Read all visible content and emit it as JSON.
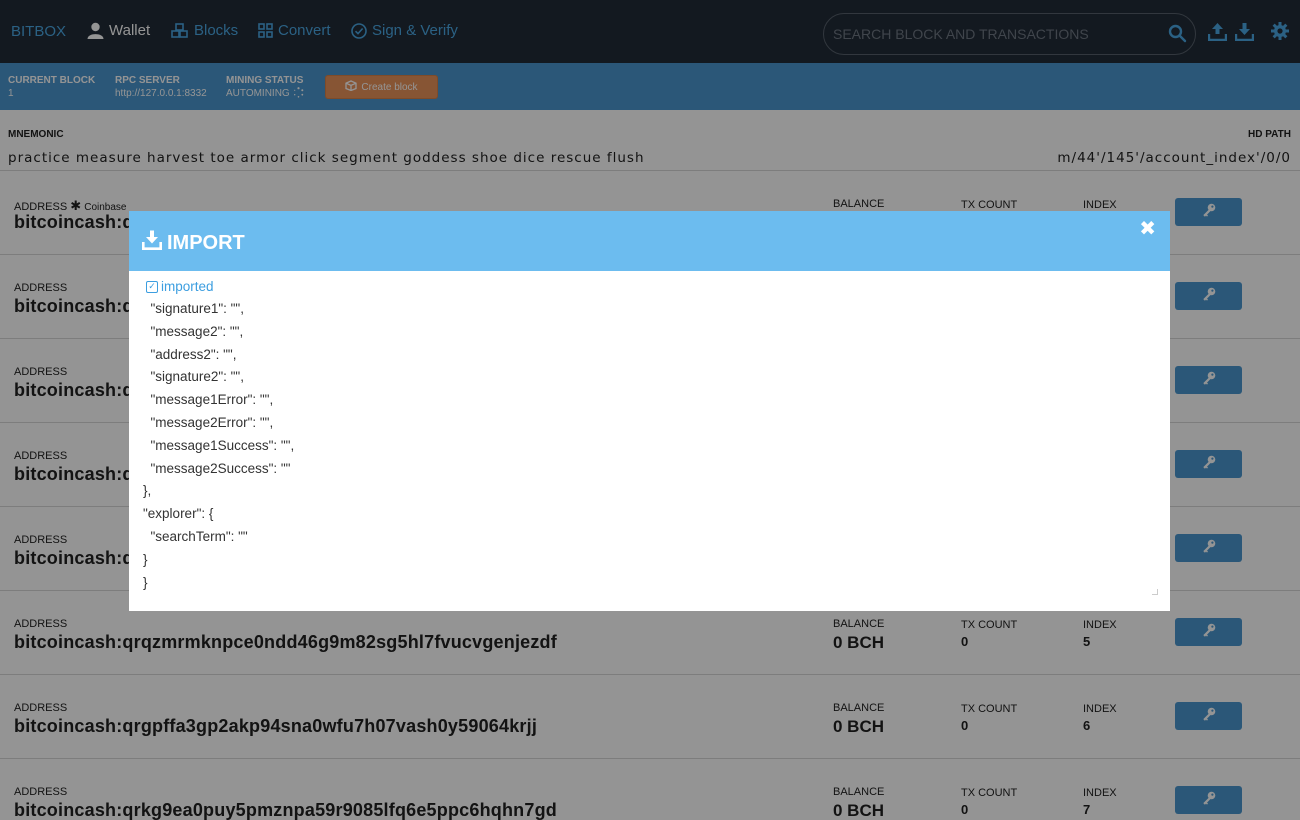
{
  "nav": {
    "brand": "BITBOX",
    "wallet": "Wallet",
    "blocks": "Blocks",
    "convert": "Convert",
    "sign": "Sign & Verify",
    "search_placeholder": "SEARCH BLOCK AND TRANSACTIONS",
    "icons": [
      "user-icon",
      "cubes-icon",
      "grid-icon",
      "check-circle-icon",
      "search-icon",
      "upload-icon",
      "download-icon",
      "gear-icon"
    ]
  },
  "status": {
    "current_block_label": "CURRENT BLOCK",
    "current_block_value": "1",
    "rpc_label": "RPC SERVER",
    "rpc_value": "http://127.0.0.1:8332",
    "mining_label": "MINING STATUS",
    "mining_value": "AUTOMINING",
    "create_block": "Create block"
  },
  "mnemonic": {
    "label": "MNEMONIC",
    "value": "practice measure harvest toe armor click segment goddess shoe dice rescue flush",
    "hd_label": "HD PATH",
    "hd_value": "m/44'/145'/account_index'/0/0"
  },
  "rows": [
    {
      "address_label": "ADDRESS",
      "coinbase": "Coinbase",
      "address": "bitcoincash:q",
      "balance_label": "BALANCE",
      "balance": "",
      "tx_label": "TX COUNT",
      "tx": "",
      "index_label": "INDEX",
      "index": ""
    },
    {
      "address_label": "ADDRESS",
      "address": "bitcoincash:q",
      "balance_label": "",
      "balance": "",
      "tx_label": "",
      "tx": "",
      "index_label": "",
      "index": ""
    },
    {
      "address_label": "ADDRESS",
      "address": "bitcoincash:q",
      "balance_label": "",
      "balance": "",
      "tx_label": "",
      "tx": "",
      "index_label": "",
      "index": ""
    },
    {
      "address_label": "ADDRESS",
      "address": "bitcoincash:q",
      "balance_label": "",
      "balance": "",
      "tx_label": "",
      "tx": "",
      "index_label": "",
      "index": ""
    },
    {
      "address_label": "ADDRESS",
      "address": "bitcoincash:q",
      "balance_label": "",
      "balance": "",
      "tx_label": "",
      "tx": "",
      "index_label": "",
      "index": ""
    },
    {
      "address_label": "ADDRESS",
      "address": "bitcoincash:qrqzmrmknpce0ndd46g9m82sg5hl7fvucvgenjezdf",
      "balance_label": "BALANCE",
      "balance": "0 BCH",
      "tx_label": "TX COUNT",
      "tx": "0",
      "index_label": "INDEX",
      "index": "5"
    },
    {
      "address_label": "ADDRESS",
      "address": "bitcoincash:qrgpffa3gp2akp94sna0wfu7h07vash0y59064krjj",
      "balance_label": "BALANCE",
      "balance": "0 BCH",
      "tx_label": "TX COUNT",
      "tx": "0",
      "index_label": "INDEX",
      "index": "6"
    },
    {
      "address_label": "ADDRESS",
      "address": "bitcoincash:qrkg9ea0puy5pmznpa59r9085lfq6e5ppc6hqhn7gd",
      "balance_label": "BALANCE",
      "balance": "0 BCH",
      "tx_label": "TX COUNT",
      "tx": "0",
      "index_label": "INDEX",
      "index": "7"
    }
  ],
  "modal": {
    "title": "IMPORT",
    "checkbox_label": "imported",
    "checkbox_checked": true,
    "lines": [
      "  \"signature1\": \"\",",
      "  \"message2\": \"\",",
      "  \"address2\": \"\",",
      "  \"signature2\": \"\",",
      "  \"message1Error\": \"\",",
      "  \"message2Error\": \"\",",
      "  \"message1Success\": \"\",",
      "  \"message2Success\": \"\"",
      "},",
      "\"explorer\": {",
      "  \"searchTerm\": \"\"",
      "}",
      "}"
    ]
  },
  "colors": {
    "nav_bg": "#212b37",
    "accent": "#4b97cf",
    "link": "#4aa8e4",
    "modal_header": "#6cbcef",
    "create_button": "#e8935b"
  }
}
